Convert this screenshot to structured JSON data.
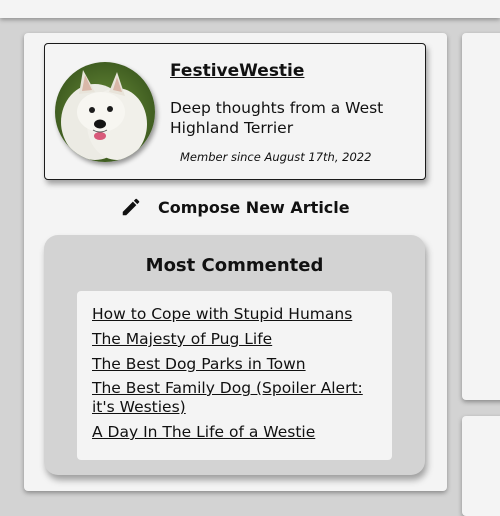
{
  "profile": {
    "username": "FestiveWestie",
    "tagline": "Deep thoughts from a West Highland Terrier",
    "member_since": "Member since August 17th, 2022"
  },
  "compose": {
    "icon": "pencil-icon",
    "label": "Compose New Article"
  },
  "most_commented": {
    "title": "Most Commented",
    "articles": [
      "How to Cope with Stupid Humans",
      "The Majesty of Pug Life",
      "The Best Dog Parks in Town",
      "The Best Family Dog (Spoiler Alert: it's Westies)",
      "A Day In The Life of a Westie"
    ]
  },
  "colors": {
    "page_background": "#d3d3d3",
    "panel_background": "#f4f4f4",
    "text": "#111111"
  }
}
